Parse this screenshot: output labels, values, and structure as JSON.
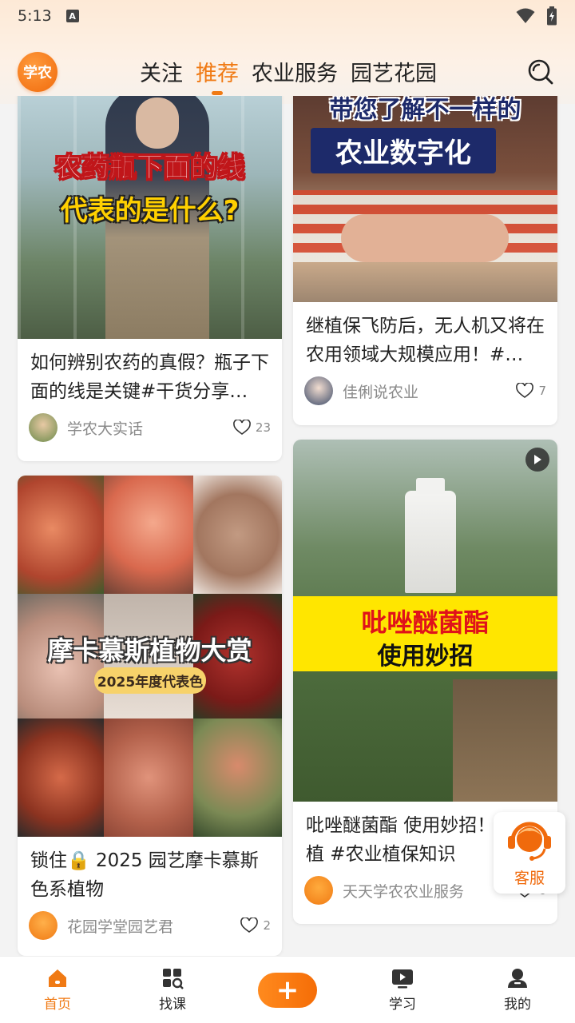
{
  "status_bar": {
    "time": "5:13",
    "notif_icon": "A"
  },
  "header": {
    "logo_text": "学农",
    "tabs": [
      {
        "label": "关注",
        "active": false
      },
      {
        "label": "推荐",
        "active": true
      },
      {
        "label": "农业服务",
        "active": false
      },
      {
        "label": "园艺花园",
        "active": false
      }
    ]
  },
  "feed": {
    "cards": [
      {
        "overlay": [
          "农药瓶下面的线",
          "代表的是什么?"
        ],
        "title": "如何辨别农药的真假？瓶子下面的线是关键#干货分享…",
        "author": "学农大实话",
        "likes": "23"
      },
      {
        "overlay": [
          "带您了解不一样的",
          "农业数字化"
        ],
        "title": "继植保飞防后，无人机又将在农用领域大规模应用！#…",
        "author": "佳俐说农业",
        "likes": "7"
      },
      {
        "overlay": [
          "摩卡慕斯植物大赏",
          "2025年度代表色"
        ],
        "title": "锁住🔒 2025 园艺摩卡慕斯色系植物",
        "author": "花园学堂园艺君",
        "likes": "2"
      },
      {
        "overlay": [
          "吡唑醚菌酯",
          "使用妙招"
        ],
        "title": "吡唑醚菌酯 使用妙招！ 农种植 #农业植保知识",
        "author": "天天学农农业服务",
        "likes": "6"
      }
    ]
  },
  "customer_service": {
    "label": "客服"
  },
  "bottom_nav": [
    {
      "label": "首页",
      "active": true
    },
    {
      "label": "找课",
      "active": false
    },
    {
      "label": "+",
      "active": false
    },
    {
      "label": "学习",
      "active": false
    },
    {
      "label": "我的",
      "active": false
    }
  ],
  "colors": {
    "accent": "#f07a14",
    "text": "#222222",
    "muted": "#8a8a8a"
  }
}
